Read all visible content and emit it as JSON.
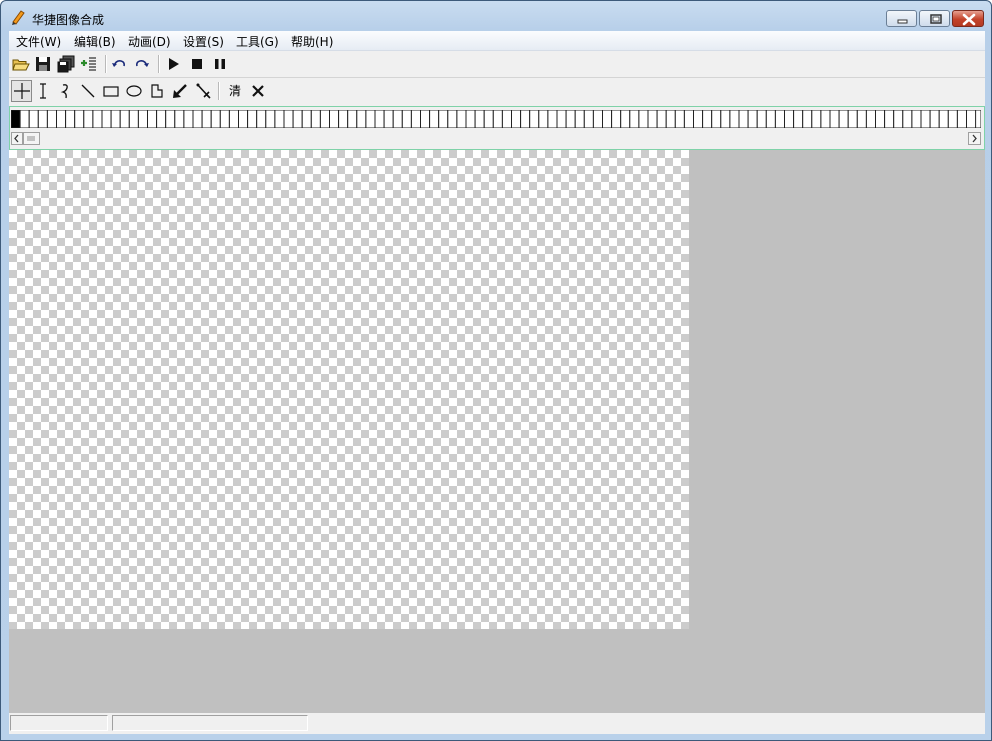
{
  "window": {
    "title": "华捷图像合成",
    "icon": "pencil-app-icon",
    "controls": [
      "minimize-icon",
      "maximize-icon",
      "close-icon"
    ]
  },
  "menubar": {
    "items": [
      {
        "label": "文件(W)"
      },
      {
        "label": "编辑(B)"
      },
      {
        "label": "动画(D)"
      },
      {
        "label": "设置(S)"
      },
      {
        "label": "工具(G)"
      },
      {
        "label": "帮助(H)"
      }
    ]
  },
  "toolbar_main": {
    "icons": [
      "open-folder-icon",
      "save-icon",
      "save-all-icon",
      "add-frame-icon",
      "undo-icon",
      "redo-icon",
      "play-icon",
      "stop-icon",
      "pause-icon"
    ]
  },
  "toolbar_draw": {
    "icons": [
      "crosshair-icon",
      "text-cursor-icon",
      "freehand-icon",
      "line-icon",
      "rectangle-icon",
      "ellipse-icon",
      "polygon-icon",
      "fill-arrow-icon",
      "eyedropper-icon"
    ],
    "clear_label": "清",
    "delete_icon": "delete-x-icon"
  },
  "frames": {
    "selected_index": 0
  },
  "statusbar": {
    "pane1": "",
    "pane2": ""
  },
  "colors": {
    "canvas_background": "#c0c0c0",
    "frames_panel_border": "#7fd2a8",
    "close_button": "#c4432b"
  }
}
